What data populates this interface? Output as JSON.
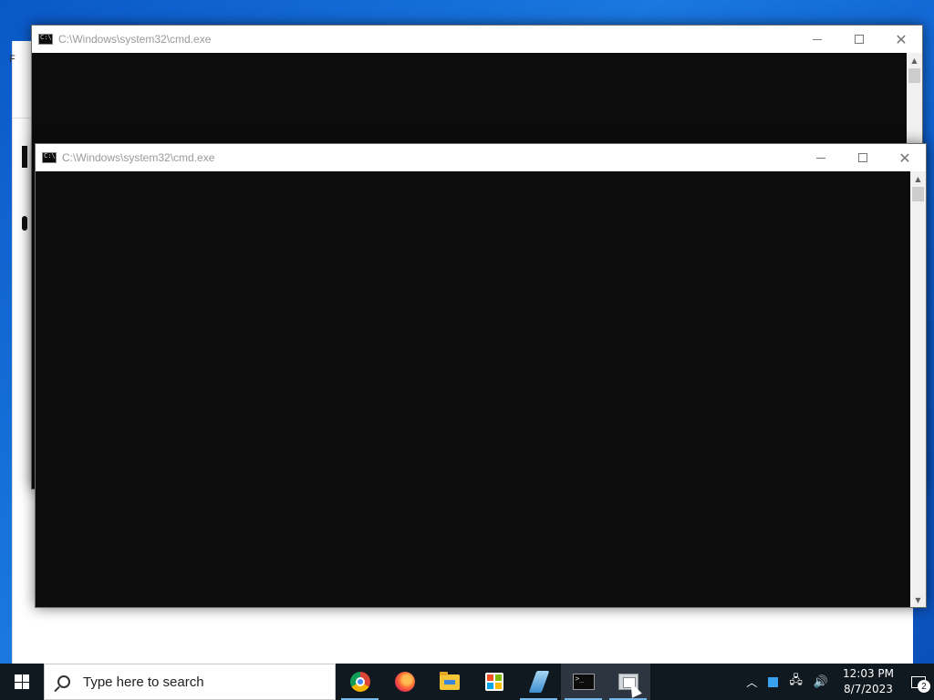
{
  "background_window": {
    "edge_text": "F"
  },
  "windows": [
    {
      "title": "C:\\Windows\\system32\\cmd.exe",
      "controls": {
        "minimize": "—",
        "maximize": "☐",
        "close": "✕"
      }
    },
    {
      "title": "C:\\Windows\\system32\\cmd.exe",
      "controls": {
        "minimize": "—",
        "maximize": "☐",
        "close": "✕"
      }
    }
  ],
  "taskbar": {
    "search_placeholder": "Type here to search",
    "apps": [
      {
        "name": "Google Chrome",
        "icon": "chrome-icon",
        "active": false
      },
      {
        "name": "Firefox",
        "icon": "firefox-icon",
        "active": false
      },
      {
        "name": "File Explorer",
        "icon": "folder-icon",
        "active": false
      },
      {
        "name": "Microsoft Store",
        "icon": "store-icon",
        "active": false
      },
      {
        "name": "Pen app",
        "icon": "pen-icon",
        "active": false
      },
      {
        "name": "Command Prompt",
        "icon": "cmd-icon",
        "active": true
      },
      {
        "name": "Multiple windows",
        "icon": "window-icon",
        "active": true
      }
    ],
    "tray": {
      "time": "12:03 PM",
      "date": "8/7/2023",
      "notification_count": "2"
    }
  },
  "colors": {
    "desktop": "#0a58c8",
    "console_bg": "#0c0c0c",
    "taskbar": "#101820",
    "active_underline": "#76b9ed"
  }
}
